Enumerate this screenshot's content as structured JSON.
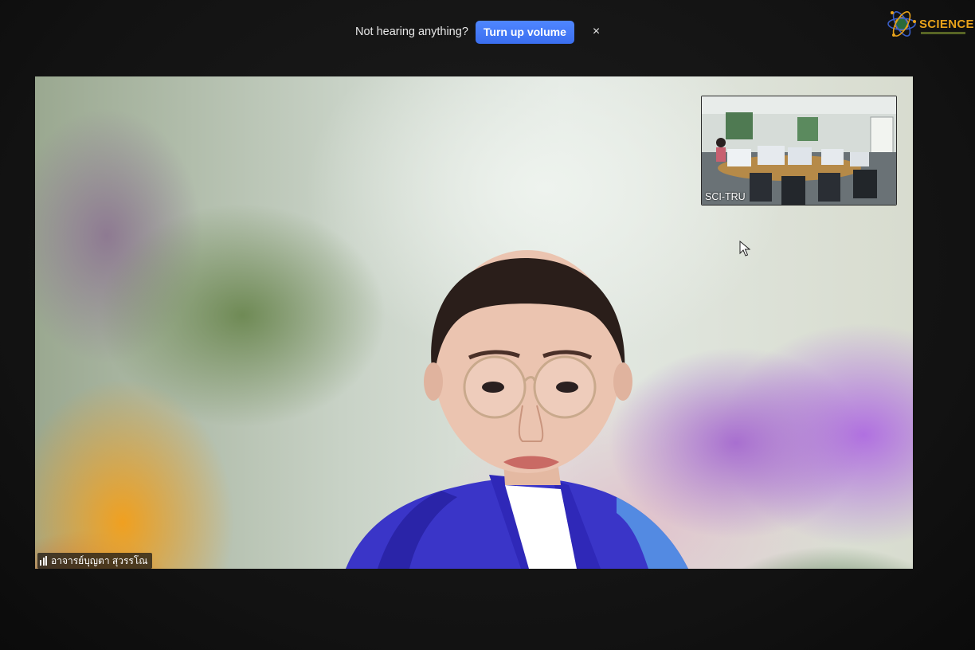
{
  "audio_banner": {
    "message": "Not hearing anything?",
    "button_label": "Turn up volume",
    "close_glyph": "×"
  },
  "logo": {
    "text": "SCIENCE",
    "icon": "atom-logo-icon"
  },
  "main_video": {
    "participant_name": "อาจารย์บุญตา  สุวรรโณ",
    "audio_icon": "audio-level-icon"
  },
  "self_view": {
    "label": "SCI-TRU"
  },
  "colors": {
    "accent": "#3b6ff0",
    "logo_orange": "#e8a21a",
    "background": "#141414"
  }
}
